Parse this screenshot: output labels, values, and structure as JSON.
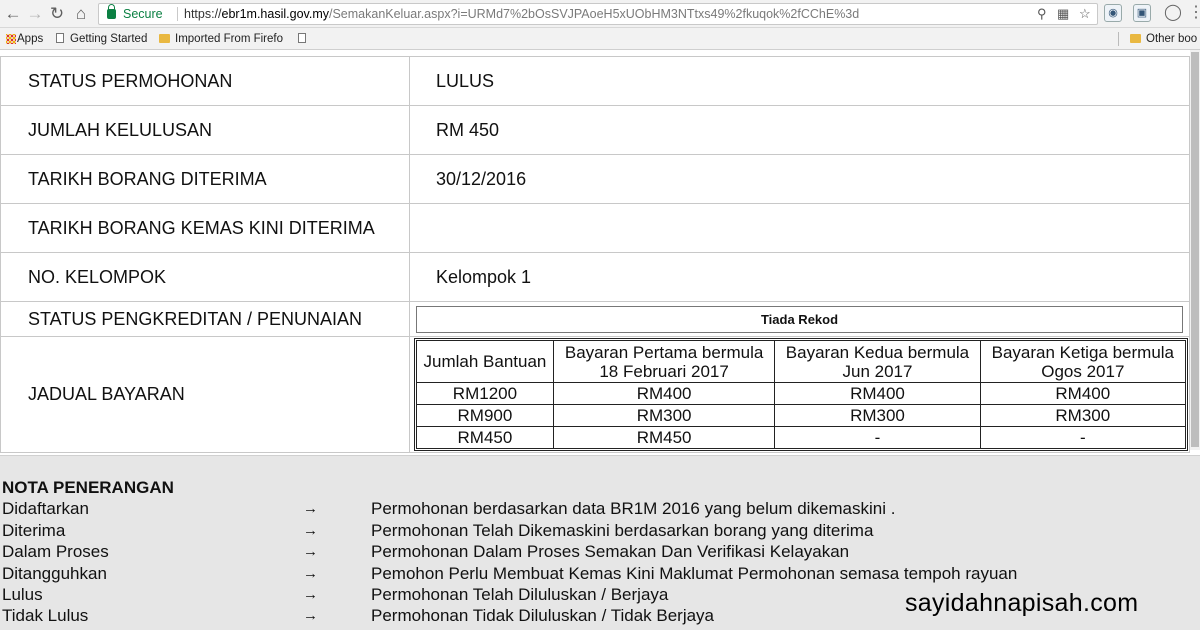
{
  "browser": {
    "secure_label": "Secure",
    "url_prefix": "https://",
    "url_host": "ebr1m.hasil.gov.my",
    "url_path": "/SemakanKeluar.aspx?i=URMd7%2bOsSVJPAoeH5xUObHM3NTtxs49%2fkuqok%2fCChE%3d",
    "bookmarks": [
      {
        "label": "Apps",
        "icon": "apps-grid-icon"
      },
      {
        "label": "Getting Started",
        "icon": "page-icon"
      },
      {
        "label": "Imported From Firefo",
        "icon": "folder-icon"
      },
      {
        "label": "",
        "icon": "page-icon"
      }
    ],
    "other_bookmarks": "Other boo"
  },
  "status_rows": [
    {
      "label": "STATUS PERMOHONAN",
      "value": "LULUS"
    },
    {
      "label": "JUMLAH KELULUSAN",
      "value": "RM 450"
    },
    {
      "label": "TARIKH BORANG DITERIMA",
      "value": "30/12/2016"
    },
    {
      "label": "TARIKH BORANG KEMAS KINI DITERIMA",
      "value": ""
    },
    {
      "label": "NO. KELOMPOK",
      "value": "Kelompok 1"
    }
  ],
  "crediting": {
    "label": "STATUS PENGKREDITAN / PENUNAIAN",
    "value": "Tiada Rekod"
  },
  "schedule": {
    "label": "JADUAL BAYARAN",
    "headers": [
      "Jumlah Bantuan",
      "Bayaran Pertama bermula 18 Februari 2017",
      "Bayaran Kedua bermula Jun 2017",
      "Bayaran Ketiga bermula Ogos 2017"
    ],
    "rows": [
      [
        "RM1200",
        "RM400",
        "RM400",
        "RM400"
      ],
      [
        "RM900",
        "RM300",
        "RM300",
        "RM300"
      ],
      [
        "RM450",
        "RM450",
        "-",
        "-"
      ]
    ]
  },
  "notes": {
    "title": "NOTA PENERANGAN",
    "arrow": "→",
    "items": [
      {
        "term": "Didaftarkan",
        "desc": "Permohonan berdasarkan data BR1M 2016 yang belum dikemaskini ."
      },
      {
        "term": "Diterima",
        "desc": "Permohonan Telah Dikemaskini berdasarkan borang yang diterima"
      },
      {
        "term": "Dalam Proses",
        "desc": "Permohonan Dalam Proses Semakan Dan Verifikasi Kelayakan"
      },
      {
        "term": "Ditangguhkan",
        "desc": "Pemohon Perlu Membuat Kemas Kini Maklumat Permohonan semasa tempoh rayuan"
      },
      {
        "term": "Lulus",
        "desc": "Permohonan Telah Diluluskan / Berjaya"
      },
      {
        "term": "Tidak Lulus",
        "desc": "Permohonan Tidak Diluluskan / Tidak Berjaya"
      }
    ]
  },
  "watermark": "sayidahnapisah.com"
}
